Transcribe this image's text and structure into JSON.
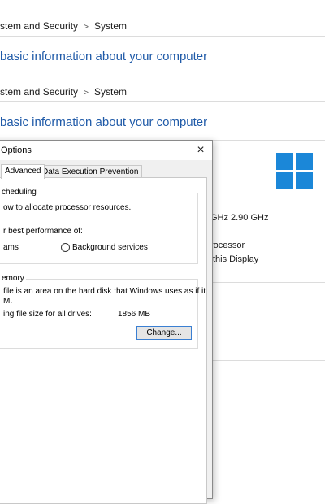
{
  "breadcrumb_top": {
    "segment1": "stem and Security",
    "segment2": "System"
  },
  "title_top": "basic information about your computer",
  "breadcrumb_mid": {
    "segment1": "stem and Security",
    "segment2": "System"
  },
  "title_mid": "basic information about your computer",
  "system_info": {
    "cpu_speed_partial": "GHz",
    "cpu_speed": "2.90 GHz",
    "processor_partial": "rocessor",
    "display_partial": "this Display"
  },
  "dialog": {
    "title": "Options",
    "close_glyph": "×",
    "tabs": [
      {
        "label": "Advanced"
      },
      {
        "label": "Data Execution Prevention"
      }
    ],
    "scheduling": {
      "group_label": "cheduling",
      "line1": "ow to allocate processor resources.",
      "line2": "r best performance of:",
      "option_programs": "ams",
      "option_background": "Background services"
    },
    "virtual_memory": {
      "group_label": "emory",
      "line1": "file is an area on the hard disk that Windows uses as if it",
      "line2": "M.",
      "size_label": "ing file size for all drives:",
      "size_value": "1856 MB",
      "change_button": "Change..."
    }
  },
  "colors": {
    "accent_title": "#1f5aa8",
    "windows_logo": "#1b87d8",
    "button_border": "#3a7fd2"
  }
}
